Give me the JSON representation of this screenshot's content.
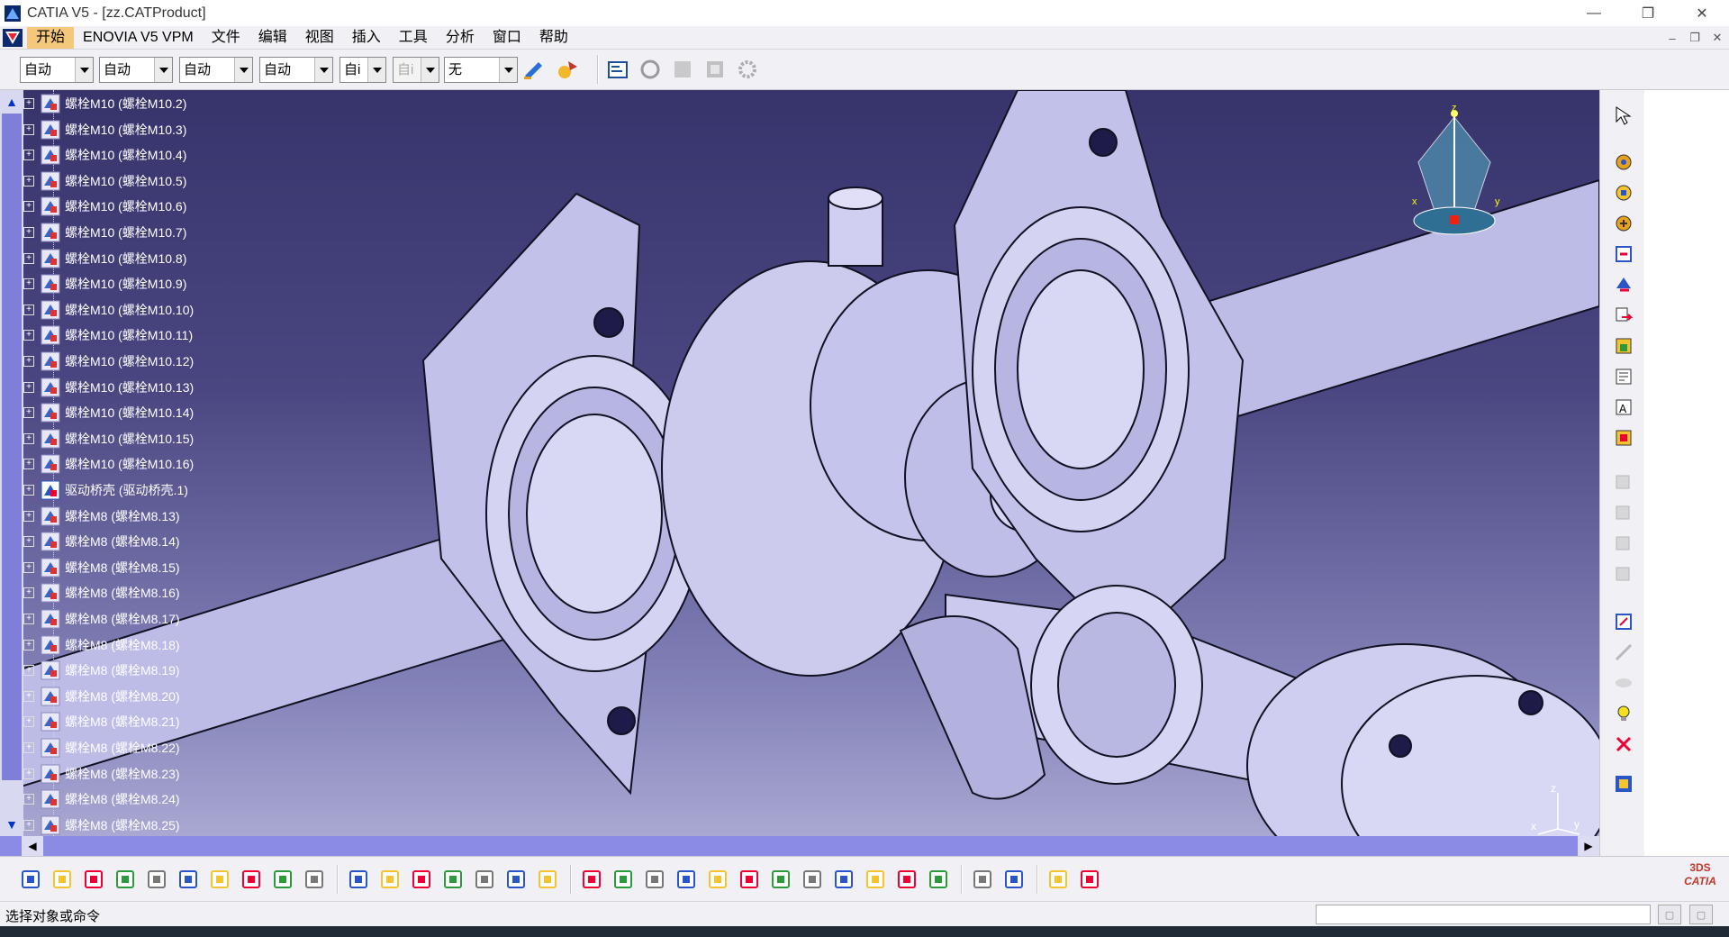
{
  "window": {
    "title": "CATIA V5 - [zz.CATProduct]",
    "controls": [
      "—",
      "❐",
      "✕"
    ]
  },
  "menu": {
    "items": [
      "开始",
      "ENOVIA V5 VPM",
      "文件",
      "编辑",
      "视图",
      "插入",
      "工具",
      "分析",
      "窗口",
      "帮助"
    ],
    "active_index": 0,
    "mdi_controls": [
      "–",
      "❐",
      "✕"
    ]
  },
  "toolbar_top": {
    "combos": [
      {
        "value": "自动",
        "disabled": false
      },
      {
        "value": "自动",
        "disabled": false
      },
      {
        "value": "自动",
        "disabled": false
      },
      {
        "value": "自动",
        "disabled": false
      },
      {
        "value": "自i",
        "disabled": false
      },
      {
        "value": "自i",
        "disabled": true
      },
      {
        "value": "无",
        "disabled": false
      }
    ],
    "icons": [
      "painter-icon",
      "apply-material-icon",
      "properties-icon",
      "catalog-browser-icon",
      "manage-icon",
      "macro-icon",
      "gear-assembly-icon"
    ]
  },
  "tree": {
    "items": [
      {
        "label": "螺栓M10 (螺栓M10.2)",
        "icon": "part-icon"
      },
      {
        "label": "螺栓M10 (螺栓M10.3)",
        "icon": "part-icon"
      },
      {
        "label": "螺栓M10 (螺栓M10.4)",
        "icon": "part-icon"
      },
      {
        "label": "螺栓M10 (螺栓M10.5)",
        "icon": "part-icon"
      },
      {
        "label": "螺栓M10 (螺栓M10.6)",
        "icon": "part-icon"
      },
      {
        "label": "螺栓M10 (螺栓M10.7)",
        "icon": "part-icon"
      },
      {
        "label": "螺栓M10 (螺栓M10.8)",
        "icon": "part-icon"
      },
      {
        "label": "螺栓M10 (螺栓M10.9)",
        "icon": "part-icon"
      },
      {
        "label": "螺栓M10 (螺栓M10.10)",
        "icon": "part-icon"
      },
      {
        "label": "螺栓M10 (螺栓M10.11)",
        "icon": "part-icon"
      },
      {
        "label": "螺栓M10 (螺栓M10.12)",
        "icon": "part-icon"
      },
      {
        "label": "螺栓M10 (螺栓M10.13)",
        "icon": "part-icon"
      },
      {
        "label": "螺栓M10 (螺栓M10.14)",
        "icon": "part-icon"
      },
      {
        "label": "螺栓M10 (螺栓M10.15)",
        "icon": "part-icon"
      },
      {
        "label": "螺栓M10 (螺栓M10.16)",
        "icon": "part-icon"
      },
      {
        "label": "驱动桥壳 (驱动桥壳.1)",
        "icon": "housing-part-icon"
      },
      {
        "label": "螺栓M8 (螺栓M8.13)",
        "icon": "part-icon"
      },
      {
        "label": "螺栓M8 (螺栓M8.14)",
        "icon": "part-icon"
      },
      {
        "label": "螺栓M8 (螺栓M8.15)",
        "icon": "part-icon"
      },
      {
        "label": "螺栓M8 (螺栓M8.16)",
        "icon": "part-icon"
      },
      {
        "label": "螺栓M8 (螺栓M8.17)",
        "icon": "part-icon"
      },
      {
        "label": "螺栓M8 (螺栓M8.18)",
        "icon": "part-icon"
      },
      {
        "label": "螺栓M8 (螺栓M8.19)",
        "icon": "part-icon"
      },
      {
        "label": "螺栓M8 (螺栓M8.20)",
        "icon": "part-icon"
      },
      {
        "label": "螺栓M8 (螺栓M8.21)",
        "icon": "part-icon"
      },
      {
        "label": "螺栓M8 (螺栓M8.22)",
        "icon": "part-icon"
      },
      {
        "label": "螺栓M8 (螺栓M8.23)",
        "icon": "part-icon"
      },
      {
        "label": "螺栓M8 (螺栓M8.24)",
        "icon": "part-icon"
      },
      {
        "label": "螺栓M8 (螺栓M8.25)",
        "icon": "part-icon"
      }
    ]
  },
  "compass": {
    "axes": [
      "x",
      "y",
      "z"
    ]
  },
  "axis_triad": {
    "labels": [
      "z",
      "x",
      "y"
    ]
  },
  "colors": {
    "viewport_top": "#37336b",
    "viewport_bottom": "#a9a8d2",
    "model_face": "#c9c8ec",
    "model_edge": "#111122",
    "menu_active": "#f5c77a",
    "scrollbar": "#8b8be6"
  },
  "right_toolbar": {
    "icons": [
      "select-icon",
      "existing-component-icon",
      "existing-component-positioning-icon",
      "new-component-icon",
      "new-product-icon",
      "new-part-icon",
      "replace-component-icon",
      "graph-tree-reordering-icon",
      "generate-numbering-icon",
      "selective-load-icon",
      "manage-representations-icon",
      "multi-instantiation-icon",
      "fast-multi-instantiation-icon",
      "explode-icon",
      "stop-manipulate-icon",
      "manipulation-icon",
      "snap-icon",
      "smart-move-icon",
      "hide-show-icon",
      "swap-visible-space-icon",
      "catalog-icon"
    ]
  },
  "bottom_toolbar": {
    "icons": [
      "new-icon",
      "open-icon",
      "save-icon",
      "print-icon",
      "cut-icon",
      "copy-icon",
      "paste-icon",
      "undo-icon",
      "redo-icon",
      "whats-this-icon",
      "formula-icon",
      "comment-icon",
      "light-icon",
      "table-icon",
      "tree-expand-icon",
      "measure-icon",
      "analysis-icon",
      "fly-mode-icon",
      "fit-all-icon",
      "pan-icon",
      "rotate-icon",
      "zoom-in-icon",
      "zoom-out-icon",
      "normal-view-icon",
      "multi-view-icon",
      "iso-view-icon",
      "shading-icon",
      "hide-icon",
      "swap-icon",
      "constraint-icon",
      "fix-icon",
      "snapshot-icon",
      "camera-icon"
    ]
  },
  "status": {
    "message": "选择对象或命令",
    "command_input": ""
  },
  "branding": {
    "logo_text": "CATIA",
    "logo_mark": "3DS"
  }
}
